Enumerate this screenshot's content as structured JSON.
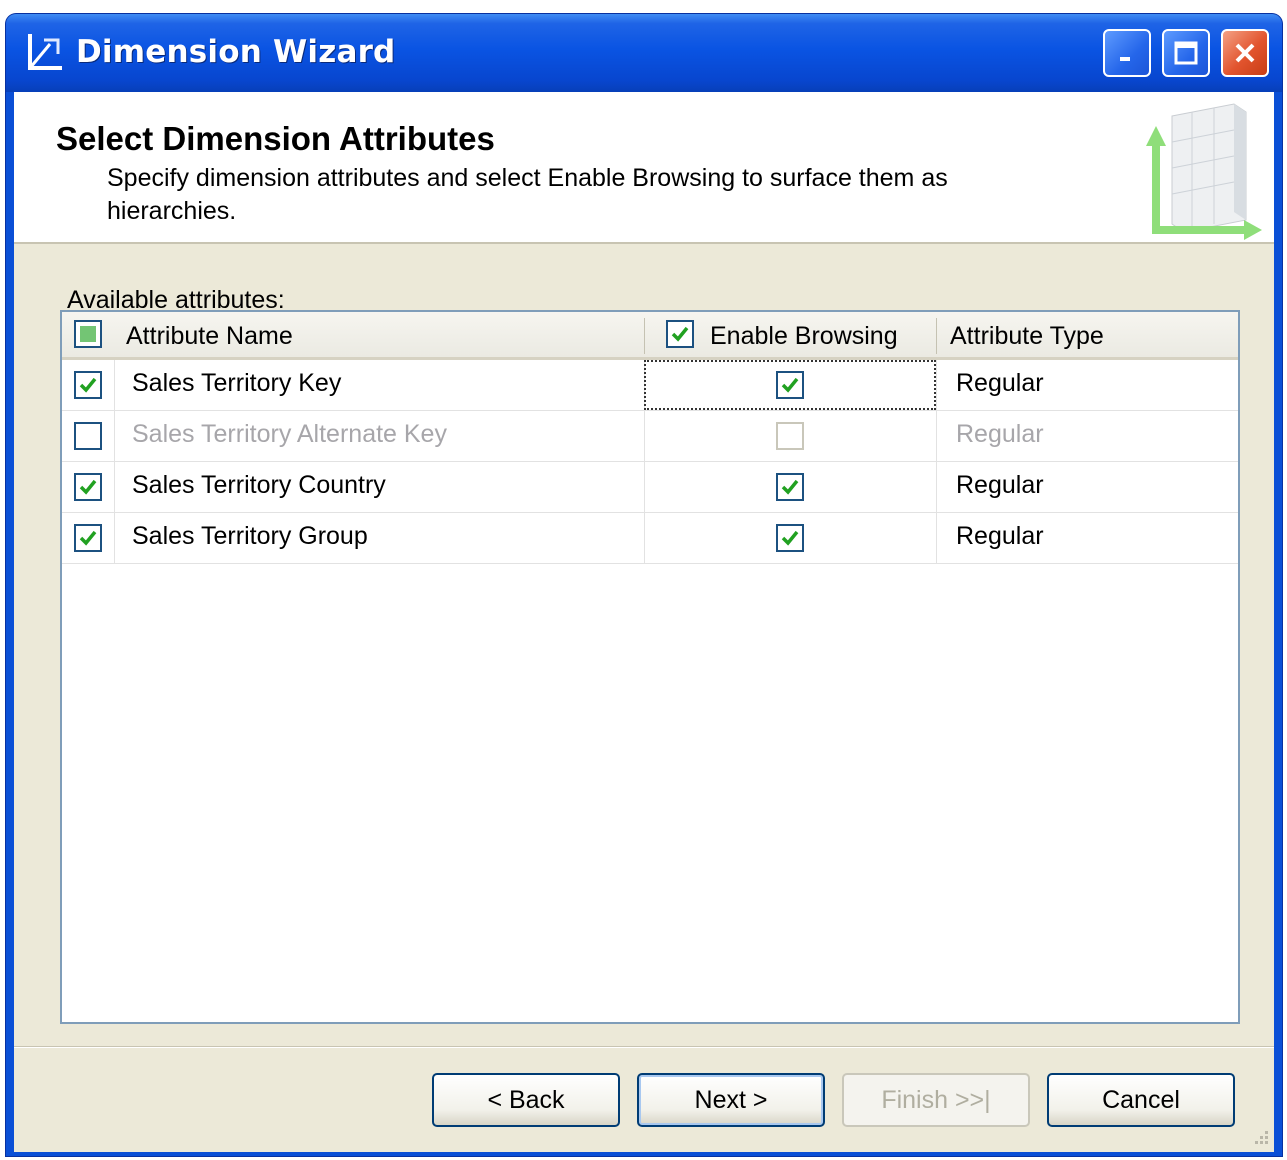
{
  "window": {
    "title": "Dimension Wizard",
    "colors": {
      "titlebar": "#0a54e3",
      "client": "#ece9d8",
      "check": "#21a121"
    }
  },
  "header": {
    "title": "Select Dimension Attributes",
    "description": "Specify dimension attributes and select Enable Browsing to surface them as hierarchies."
  },
  "attributes": {
    "label": "Available attributes:",
    "columns": {
      "name": "Attribute Name",
      "browsing": "Enable Browsing",
      "type": "Attribute Type"
    },
    "header_select_all_state": "partial",
    "header_browsing_checked": true,
    "rows": [
      {
        "selected": true,
        "name": "Sales Territory Key",
        "enable_browsing": true,
        "type": "Regular",
        "enabled": true
      },
      {
        "selected": false,
        "name": "Sales Territory Alternate Key",
        "enable_browsing": false,
        "type": "Regular",
        "enabled": false
      },
      {
        "selected": true,
        "name": "Sales Territory Country",
        "enable_browsing": true,
        "type": "Regular",
        "enabled": true
      },
      {
        "selected": true,
        "name": "Sales Territory Group",
        "enable_browsing": true,
        "type": "Regular",
        "enabled": true
      }
    ]
  },
  "buttons": {
    "back": "< Back",
    "next": "Next >",
    "finish": "Finish >>|",
    "cancel": "Cancel"
  }
}
